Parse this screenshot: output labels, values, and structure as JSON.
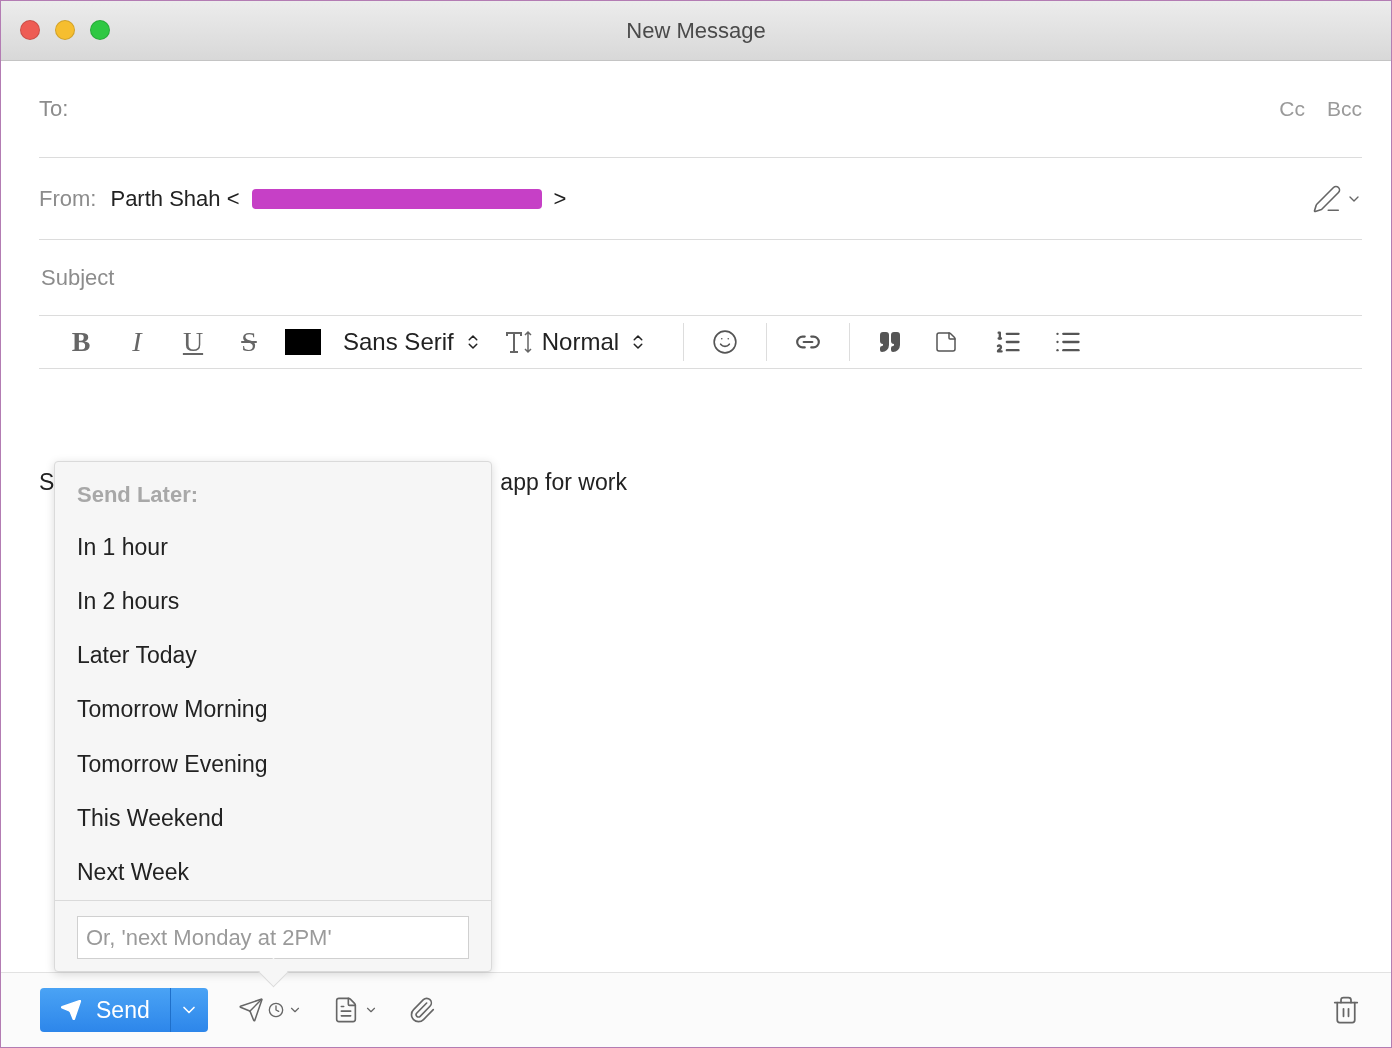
{
  "window": {
    "title": "New Message"
  },
  "to": {
    "label": "To:",
    "cc": "Cc",
    "bcc": "Bcc"
  },
  "from": {
    "label": "From:",
    "value_start": "Parth Shah <",
    "value_end": ">"
  },
  "subject": {
    "placeholder": "Subject"
  },
  "toolbar": {
    "format_buttons": [
      {
        "label": "B",
        "kind": "bold"
      },
      {
        "label": "I",
        "kind": "italic"
      },
      {
        "label": "U",
        "kind": "underline"
      },
      {
        "label": "S",
        "kind": "strike"
      }
    ],
    "font": "Sans Serif",
    "size": "Normal"
  },
  "body": {
    "visible_start": "S",
    "visible_end": "app for work"
  },
  "send_later": {
    "title": "Send Later:",
    "options": [
      "In 1 hour",
      "In 2 hours",
      "Later Today",
      "Tomorrow Morning",
      "Tomorrow Evening",
      "This Weekend",
      "Next Week"
    ],
    "input_placeholder": "Or, 'next Monday at 2PM'"
  },
  "footer": {
    "send": "Send"
  }
}
